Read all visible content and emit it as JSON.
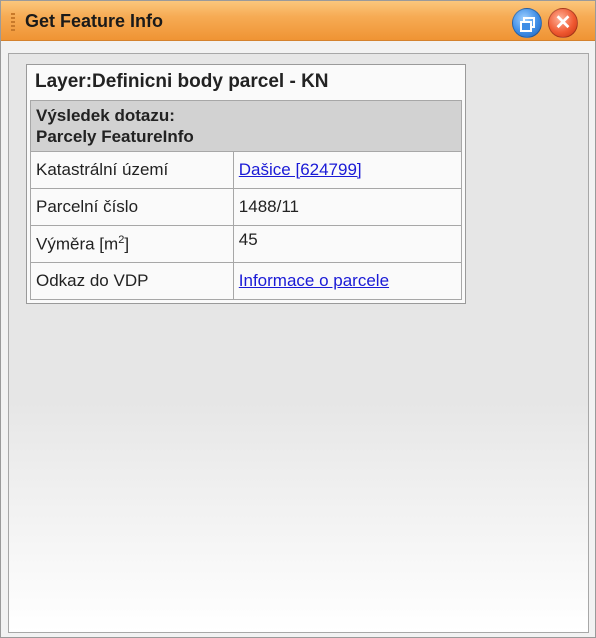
{
  "window": {
    "title": "Get Feature Info",
    "buttons": [
      {
        "name": "restore",
        "icon": "restore-icon",
        "color": "#3f8ee6"
      },
      {
        "name": "close",
        "icon": "close-icon",
        "color": "#f05a32"
      }
    ]
  },
  "panel": {
    "layer_header": "Layer:Definicni body parcel - KN",
    "query_title_line1": "Výsledek dotazu:",
    "query_title_line2": "Parcely FeatureInfo",
    "rows": [
      {
        "label": "Katastrální území",
        "value": "Dašice [624799]",
        "is_link": true
      },
      {
        "label": "Parcelní číslo",
        "value": "1488/11",
        "is_link": false
      },
      {
        "label": "Výměra [m",
        "label_sup": "2",
        "label_after": "]",
        "value": "45",
        "is_link": false
      },
      {
        "label": "Odkaz do VDP",
        "value": "Informace o parcele",
        "is_link": true
      }
    ]
  },
  "colors": {
    "titlebar": "#f6ab54",
    "link": "#1a1ad6"
  }
}
